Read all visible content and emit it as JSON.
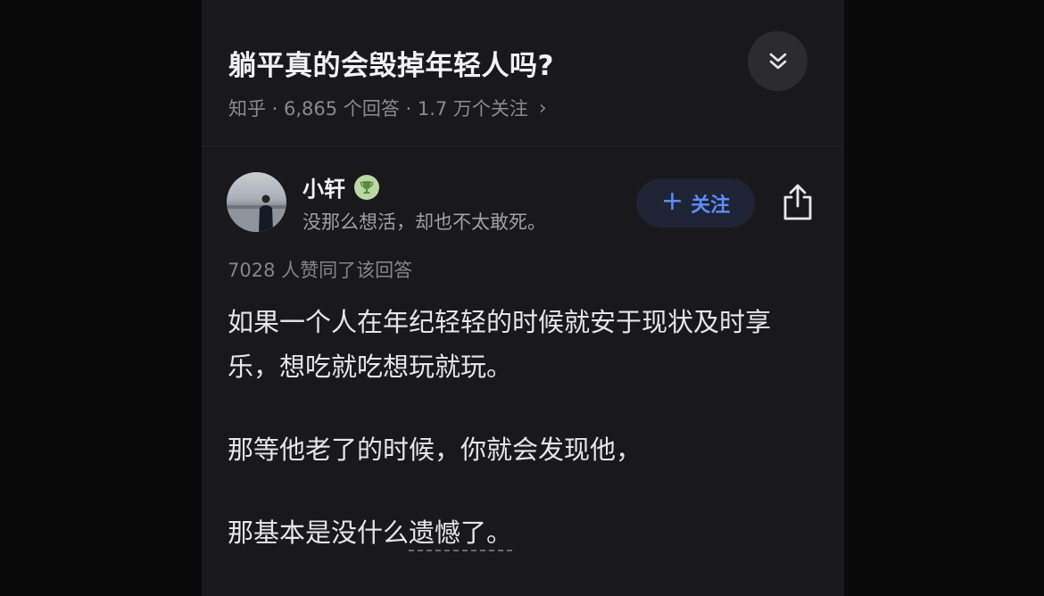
{
  "question": {
    "title": "躺平真的会毁掉年轻人吗?",
    "meta": "知乎 · 6,865 个回答 · 1.7 万个关注",
    "meta_chevron": "›"
  },
  "author": {
    "name": "小轩",
    "bio": "没那么想活，却也不太敢死。",
    "badge_icon": "trophy-icon"
  },
  "actions": {
    "follow_plus": "+",
    "follow_label": "关注"
  },
  "answer": {
    "likes": "7028 人赞同了该回答",
    "paragraphs": [
      "如果一个人在年纪轻轻的时候就安于现状及时享乐，想吃就吃想玩就玩。",
      "那等他老了的时候，你就会发现他，"
    ],
    "last_prefix": "那基本是没什么",
    "last_underlined": "遗憾了。"
  },
  "colors": {
    "background": "#19191b",
    "accent": "#5d8dff",
    "follow_bg": "#1e2433",
    "badge": "#b9d8a4"
  }
}
